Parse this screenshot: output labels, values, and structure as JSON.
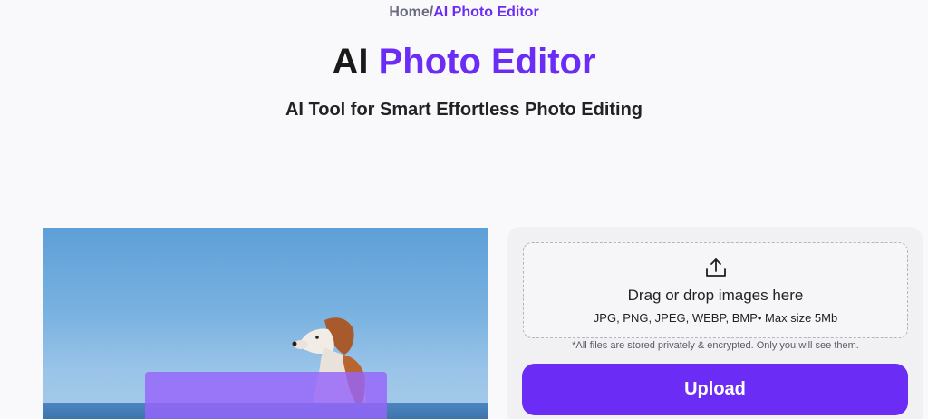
{
  "breadcrumb": {
    "home": "Home",
    "separator": "/",
    "current": "AI Photo Editor"
  },
  "heading": {
    "prefix": "AI",
    "accent": "Photo Editor"
  },
  "subtitle": "AI Tool for Smart Effortless Photo Editing",
  "upload": {
    "icon": "upload-icon",
    "drop_title": "Drag or drop images here",
    "formats": "JPG, PNG, JPEG, WEBP, BMP• Max size 5Mb",
    "privacy_note": "*All files are stored privately & encrypted. Only you will see them.",
    "button_label": "Upload"
  },
  "colors": {
    "accent": "#6b2cf5",
    "background": "#f9f9fb"
  }
}
